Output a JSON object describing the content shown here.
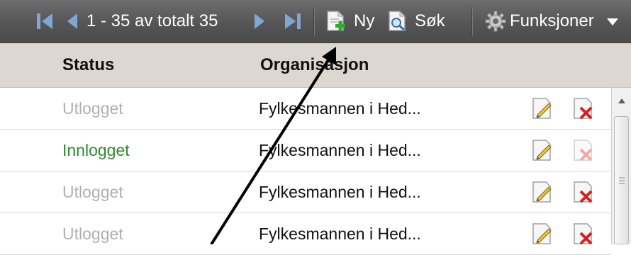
{
  "toolbar": {
    "page_info": "1 - 35 av totalt 35",
    "new_label": "Ny",
    "search_label": "Søk",
    "functions_label": "Funksjoner"
  },
  "table": {
    "columns": [
      "Status",
      "Organisasjon"
    ],
    "rows": [
      {
        "status": "Utlogget",
        "org": "Fylkesmannen i Hed..."
      },
      {
        "status": "Innlogget",
        "org": "Fylkesmannen i Hed..."
      },
      {
        "status": "Utlogget",
        "org": "Fylkesmannen i Hed..."
      },
      {
        "status": "Utlogget",
        "org": "Fylkesmannen i Hed..."
      }
    ]
  },
  "colors": {
    "status_logged_out": "#b0b0b0",
    "status_logged_in": "#2e8b2e",
    "delete_active": "#d42020",
    "delete_inactive": "#f0a8a8"
  }
}
